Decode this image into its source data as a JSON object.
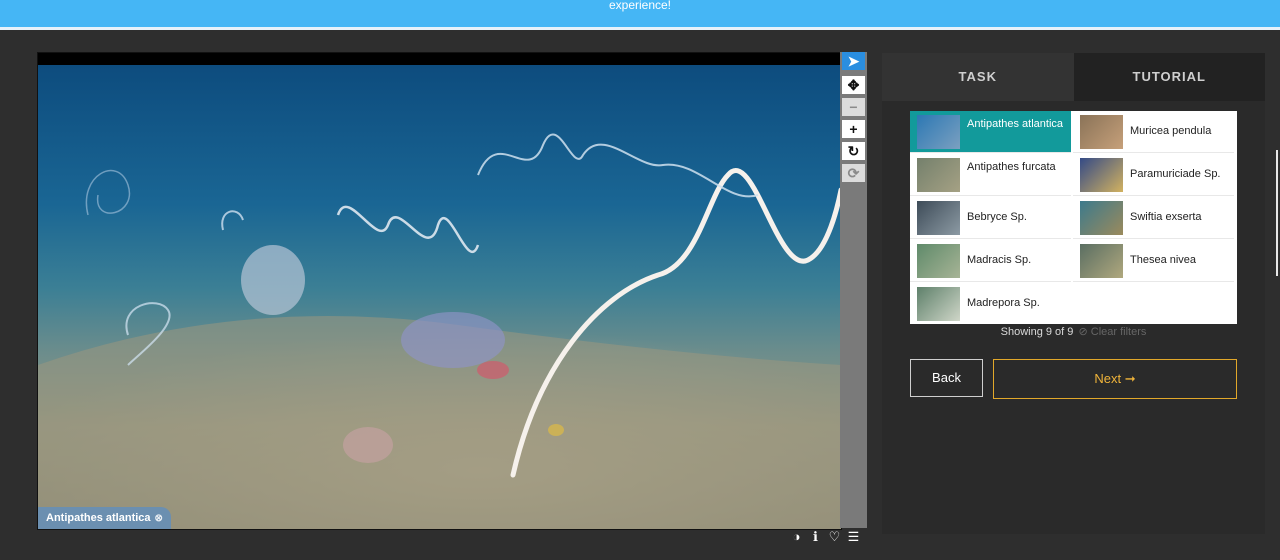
{
  "banner": {
    "text": "experience!"
  },
  "subject": {
    "label": "Antipathes atlantica",
    "remove": "⊗"
  },
  "toolbar": {
    "tools": [
      {
        "name": "pointer-tool",
        "glyph": "➤"
      },
      {
        "name": "pan-tool",
        "glyph": "✥"
      },
      {
        "name": "zoom-out-tool",
        "glyph": "−"
      },
      {
        "name": "zoom-in-tool",
        "glyph": "+"
      },
      {
        "name": "rotate-tool",
        "glyph": "↻"
      },
      {
        "name": "reset-tool",
        "glyph": "⟳"
      }
    ]
  },
  "bottom_icons": {
    "contrast": "◑",
    "info": "ℹ",
    "favorite": "♡",
    "collections": "☰"
  },
  "tabs": {
    "task": "TASK",
    "tutorial": "TUTORIAL"
  },
  "choices": [
    {
      "label": "Antipathes atlantica",
      "selected": true
    },
    {
      "label": "Muricea pendula",
      "selected": false
    },
    {
      "label": "Antipathes furcata",
      "selected": false
    },
    {
      "label": "Paramuriciade Sp.",
      "selected": false
    },
    {
      "label": "Bebryce Sp.",
      "selected": false
    },
    {
      "label": "Swiftia exserta",
      "selected": false
    },
    {
      "label": "Madracis Sp.",
      "selected": false
    },
    {
      "label": "Thesea nivea",
      "selected": false
    },
    {
      "label": "Madrepora Sp.",
      "selected": false
    }
  ],
  "filter": {
    "showing": "Showing 9 of 9",
    "clear": "Clear filters"
  },
  "buttons": {
    "back": "Back",
    "next": "Next ➞"
  },
  "colors": {
    "accent": "#45b6f5",
    "selected": "#129a9b",
    "next": "#f0b43a"
  }
}
